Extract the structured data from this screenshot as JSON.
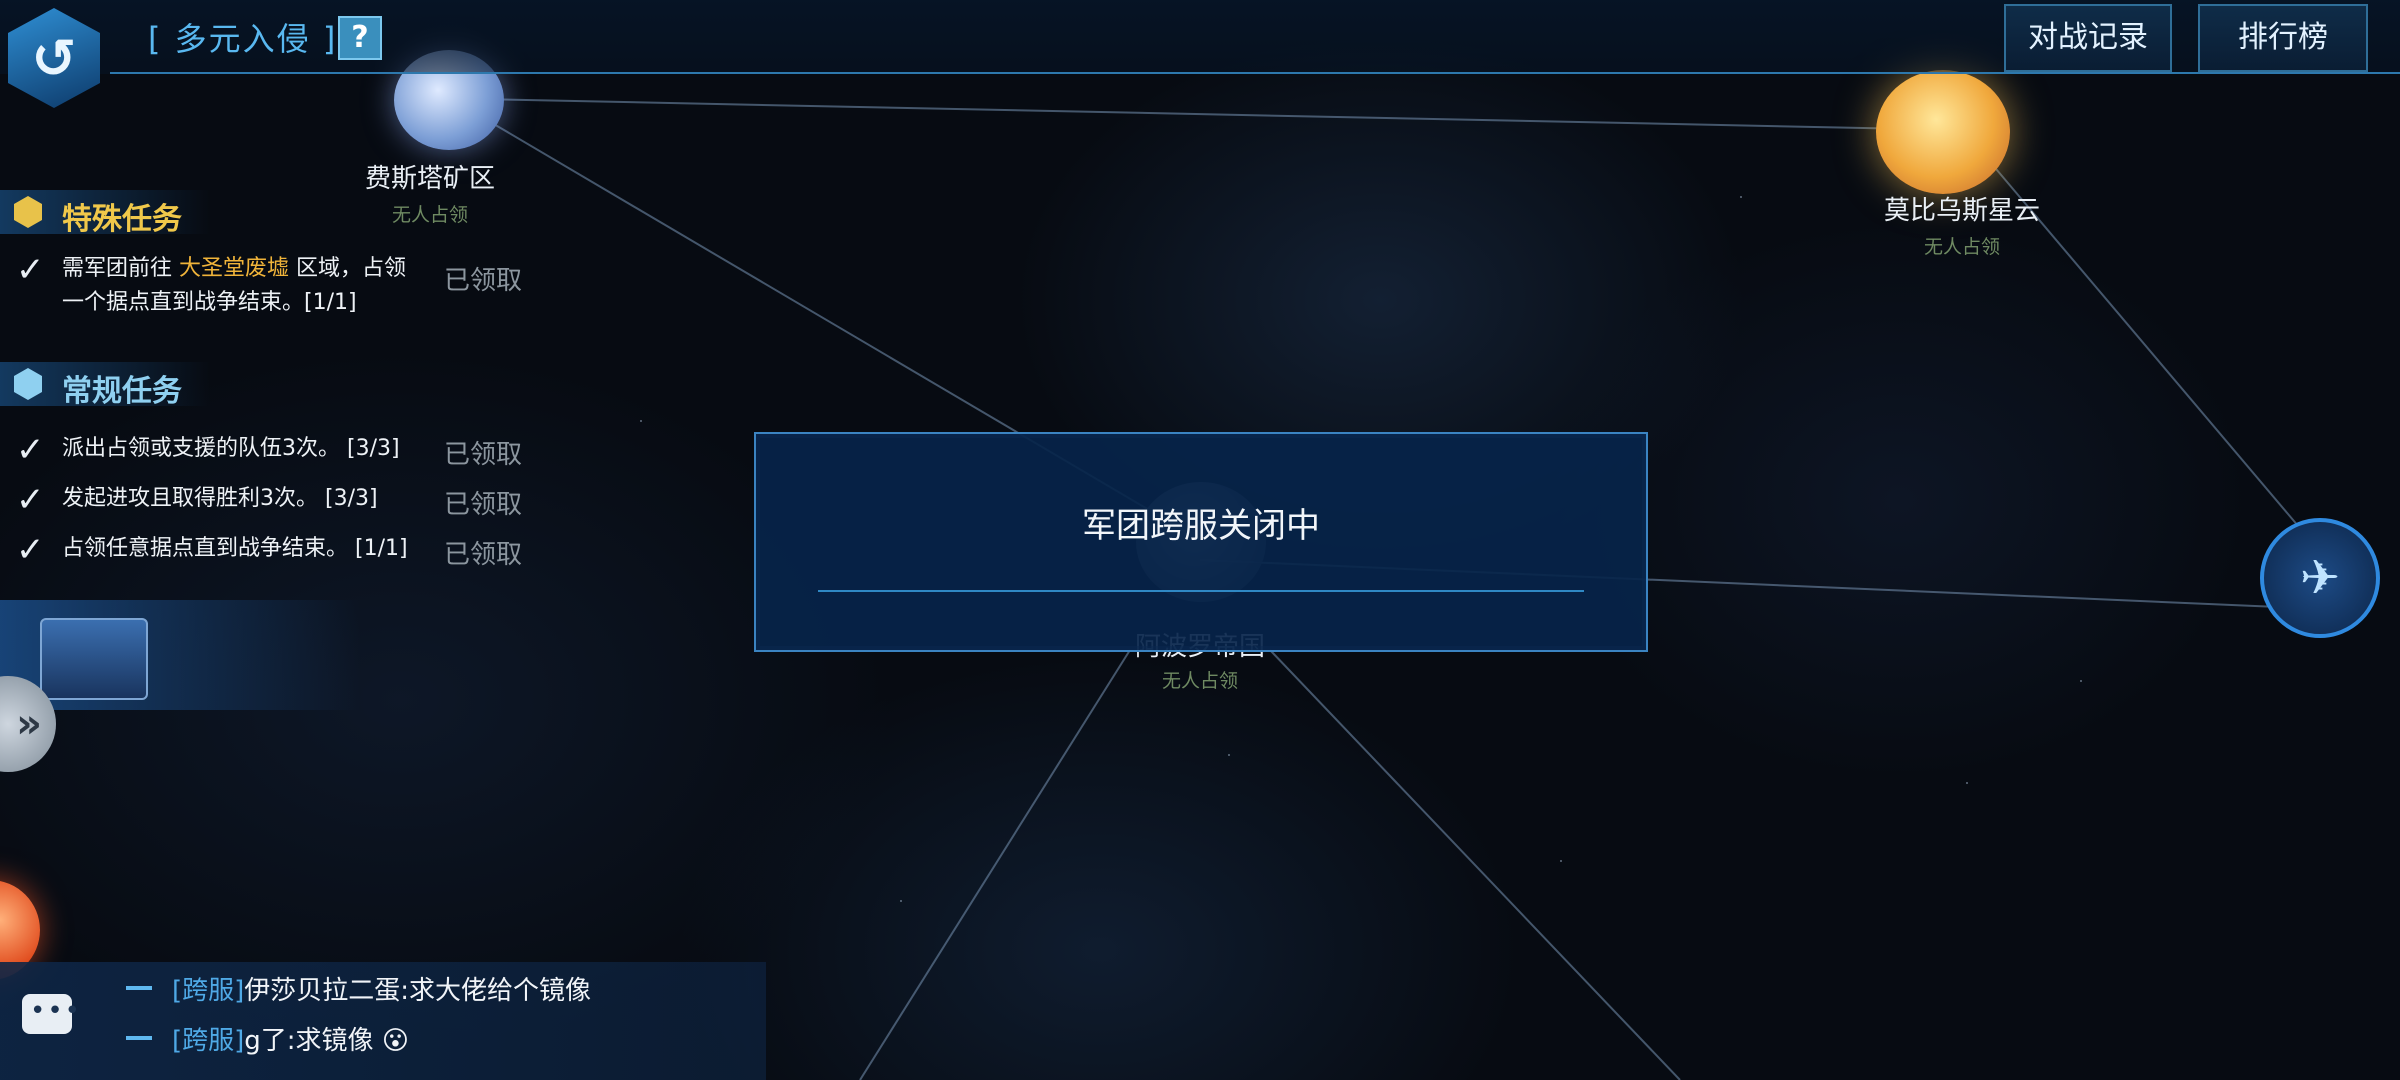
{
  "topbar": {
    "mode_title": "[ 多元入侵 ]",
    "help_label": "?",
    "battle_log_label": "对战记录",
    "ranking_label": "排行榜"
  },
  "planets": [
    {
      "name": "费斯塔矿区",
      "status": "无人占领",
      "color": "#8fb2e6"
    },
    {
      "name": "莫比乌斯星云",
      "status": "无人占领",
      "color": "#f0b84a"
    },
    {
      "name": "阿波罗帝国",
      "status": "无人占领",
      "color": "#6c7a8a"
    }
  ],
  "special_tasks": {
    "title": "特殊任务",
    "items": [
      {
        "text_before": "需军团前往",
        "highlight": "大圣堂废墟",
        "text_after": "区域，占领",
        "line2": "一个据点直到战争结束。[1/1]",
        "status": "已领取"
      }
    ]
  },
  "regular_tasks": {
    "title": "常规任务",
    "items": [
      {
        "text": "派出占领或支援的队伍3次。 [3/3]",
        "status": "已领取"
      },
      {
        "text": "发起进攻且取得胜利3次。 [3/3]",
        "status": "已领取"
      },
      {
        "text": "占领任意据点直到战争结束。 [1/1]",
        "status": "已领取"
      }
    ]
  },
  "modal": {
    "message": "军团跨服关闭中"
  },
  "chat": {
    "messages": [
      {
        "tag": "[跨服]",
        "text": "伊莎贝拉二蛋:求大佬给个镜像"
      },
      {
        "tag": "[跨服]",
        "text": "g了:求镜像 😮"
      }
    ]
  },
  "colors": {
    "accent": "#59b8f0",
    "section_title": "#f0c84a",
    "highlight": "#f0b43a"
  },
  "icons": {
    "back": "back-arrow-icon",
    "check": "check-icon",
    "fleet": "spaceship-icon",
    "chat": "chat-bubble-icon",
    "expand": "double-chevron-right-icon"
  }
}
